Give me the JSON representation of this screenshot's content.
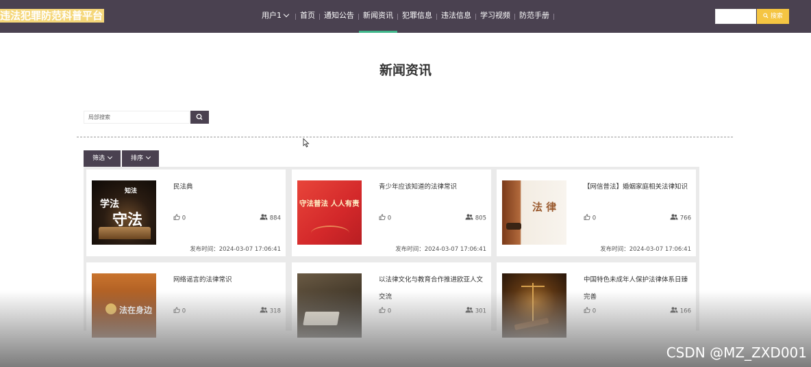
{
  "header": {
    "logo": "违法犯罪防范科普平台",
    "nav": [
      {
        "label": "用户1"
      },
      {
        "label": "首页"
      },
      {
        "label": "通知公告"
      },
      {
        "label": "新闻资讯"
      },
      {
        "label": "犯罪信息"
      },
      {
        "label": "违法信息"
      },
      {
        "label": "学习视频"
      },
      {
        "label": "防范手册"
      }
    ],
    "active_index": 3,
    "search_button": "搜索",
    "search_value": ""
  },
  "page": {
    "title": "新闻资讯",
    "local_search_placeholder": "局部搜索",
    "filter_label": "筛选",
    "sort_label": "排序"
  },
  "cards": [
    {
      "title": "民法典",
      "likes": "0",
      "views": "884",
      "date": "发布时间：2024-03-07 17:06:41",
      "thumb_text": [
        "知法",
        "学法",
        "守法"
      ]
    },
    {
      "title": "青少年应该知道的法律常识",
      "likes": "0",
      "views": "805",
      "date": "发布时间：2024-03-07 17:06:41",
      "thumb_text": [
        "守法普法 人人有责"
      ]
    },
    {
      "title": "【网信普法】婚姻家庭相关法律知识",
      "likes": "0",
      "views": "766",
      "date": "发布时间：2024-03-07 17:06:41",
      "thumb_text": [
        "法 律"
      ]
    },
    {
      "title": "网络谣言的法律常识",
      "likes": "0",
      "views": "318",
      "date": "",
      "thumb_text": [
        "法在身边"
      ]
    },
    {
      "title": "以法律文化与教育合作推进欧亚人文交流",
      "likes": "0",
      "views": "301",
      "date": "",
      "thumb_text": []
    },
    {
      "title": "中国特色未成年人保护法律体系日臻完善",
      "likes": "0",
      "views": "166",
      "date": "",
      "thumb_text": []
    }
  ],
  "watermark": "CSDN @MZ_ZXD001",
  "colors": {
    "nav_bg": "#4a4150",
    "accent": "#f5c542",
    "active_underline": "#3fb68a",
    "logo_bg": "#f5d77a"
  }
}
